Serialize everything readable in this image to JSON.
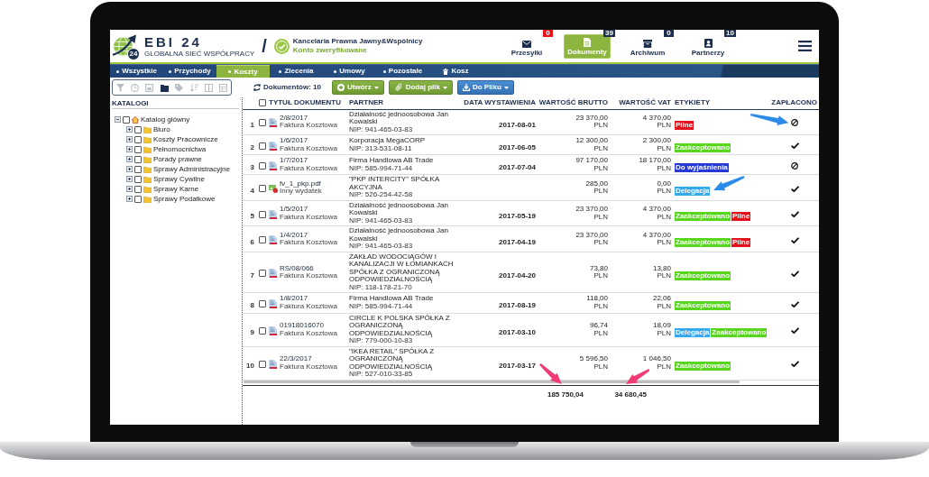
{
  "header": {
    "logo_text": "EBI 24",
    "logo_tagline": "GLOBALNA SIEĆ WSPÓŁPRACY",
    "logo_badge": "24",
    "divider": "/",
    "company": "Kancelaria Prawna Jawny&Wspólnicy",
    "account_status": "Konto zweryfikowane"
  },
  "top_nav": [
    {
      "label": "Przesyłki",
      "kind": "shipments",
      "count": "0",
      "color": "#e3141b",
      "selected": false
    },
    {
      "label": "Dokumenty",
      "kind": "documents",
      "count": "39",
      "color": "#1d2f4e",
      "selected": true
    },
    {
      "label": "Archiwum",
      "kind": "archive",
      "count": "0",
      "color": "#1d2f4e",
      "selected": false
    },
    {
      "label": "Partnerzy",
      "kind": "partners",
      "count": "10",
      "color": "#1d2f4e",
      "selected": false
    }
  ],
  "tabs": [
    {
      "label": "Wszystkie",
      "kind": "category",
      "selected": false
    },
    {
      "label": "Przychody",
      "kind": "category",
      "selected": false
    },
    {
      "label": "Koszty",
      "kind": "category",
      "selected": true
    },
    {
      "label": "Zlecenia",
      "kind": "category",
      "selected": false
    },
    {
      "label": "Umowy",
      "kind": "category",
      "selected": false
    },
    {
      "label": "Pozostałe",
      "kind": "category",
      "selected": false
    },
    {
      "label": "Kosz",
      "kind": "trash",
      "selected": false
    }
  ],
  "toolbar": {
    "tools": [
      {
        "selected": false
      },
      {
        "selected": false
      },
      {
        "selected": false
      },
      {
        "selected": true
      },
      {
        "selected": false
      },
      {
        "selected": false
      },
      {
        "selected": false
      },
      {
        "selected": false
      }
    ],
    "document_count": "Dokumentów: 10",
    "buttons": [
      {
        "label": "Utwórz",
        "kind": "create"
      },
      {
        "label": "Dodaj plik",
        "kind": "attach"
      },
      {
        "label": "Do Pliku",
        "kind": "export"
      }
    ]
  },
  "sidebar": {
    "title": "KATALOGI",
    "tree": [
      {
        "label": "Katalog główny",
        "expanded": true,
        "checked": false,
        "children": [
          {
            "label": "Biuro",
            "expanded": false,
            "checked": false
          },
          {
            "label": "Koszty Pracownicze",
            "expanded": false,
            "checked": false
          },
          {
            "label": "Pełnomocnictwa",
            "expanded": false,
            "checked": false
          },
          {
            "label": "Porady prawne",
            "expanded": false,
            "checked": false
          },
          {
            "label": "Sprawy Administracyjne",
            "expanded": false,
            "checked": false
          },
          {
            "label": "Sprawy Cywilne",
            "expanded": false,
            "checked": false
          },
          {
            "label": "Sprawy Karne",
            "expanded": false,
            "checked": false
          },
          {
            "label": "Sprawy Podatkowe",
            "expanded": false,
            "checked": false
          }
        ]
      }
    ]
  },
  "table": {
    "select_all": {
      "checked": false
    },
    "columns": [
      "TYTUŁ DOKUMENTU",
      "PARTNER",
      "DATA WYSTAWIENIA",
      "WARTOŚĆ BRUTTO",
      "WARTOŚĆ VAT",
      "ETYKIETY",
      "ZAPŁACONO"
    ],
    "rows": [
      {
        "number": "1",
        "checked": false,
        "kind": "invoice",
        "title": "2/8/2017",
        "type": "Faktura Kosztowa",
        "partner": "Działalność jednoosobowa Jan Kowalski",
        "nip": "NIP: 941-465-03-83",
        "date": "2017-08-01",
        "gross": "23 370,00",
        "gross_currency": "PLN",
        "vat": "4 370,00",
        "vat_currency": "PLN",
        "tags": [
          {
            "label": "Pilne",
            "color": "#e3111b"
          }
        ],
        "paid": false
      },
      {
        "number": "2",
        "checked": false,
        "kind": "invoice",
        "title": "1/6/2017",
        "type": "Faktura Kosztowa",
        "partner": "Korporacja MegaCORP",
        "nip": "NIP: 313-531-08-11",
        "date": "2017-06-05",
        "gross": "12 300,00",
        "gross_currency": "PLN",
        "vat": "2 300,00",
        "vat_currency": "PLN",
        "tags": [
          {
            "label": "Zaakceptowano",
            "color": "#58d61e"
          }
        ],
        "paid": true
      },
      {
        "number": "3",
        "checked": false,
        "kind": "invoice",
        "title": "1/7/2017",
        "type": "Faktura Kosztowa",
        "partner": "Firma Handlowa AB Trade",
        "nip": "NIP: 585-994-71-44",
        "date": "2017-07-04",
        "gross": "97 170,00",
        "gross_currency": "PLN",
        "vat": "18 170,00",
        "vat_currency": "PLN",
        "tags": [
          {
            "label": "Do wyjaśnienia",
            "color": "#2639d6"
          }
        ],
        "paid": false
      },
      {
        "number": "4",
        "checked": false,
        "kind": "attachment",
        "title": "fv_1_pkp.pdf",
        "type": "Inny wydatek",
        "partner": "\"PKP INTERCITY\" SPÓŁKA AKCYJNA",
        "nip": "NIP: 526-254-42-58",
        "gross": "285,00",
        "gross_currency": "PLN",
        "vat": "0,00",
        "vat_currency": "PLN",
        "tags": [
          {
            "label": "Delegacja",
            "color": "#35a8ef"
          }
        ],
        "paid": true
      },
      {
        "number": "5",
        "checked": false,
        "kind": "invoice",
        "title": "1/5/2017",
        "type": "Faktura Kosztowa",
        "partner": "Działalność jednoosobowa Jan Kowalski",
        "nip": "NIP: 941-465-03-83",
        "date": "2017-05-19",
        "gross": "23 370,00",
        "gross_currency": "PLN",
        "vat": "4 370,00",
        "vat_currency": "PLN",
        "tags": [
          {
            "label": "Zaakceptowano",
            "color": "#58d61e"
          },
          {
            "label": "Pilne",
            "color": "#e3111b"
          }
        ],
        "paid": true
      },
      {
        "number": "6",
        "checked": false,
        "kind": "invoice",
        "title": "1/4/2017",
        "type": "Faktura Kosztowa",
        "partner": "Działalność jednoosobowa Jan Kowalski",
        "nip": "NIP: 941-465-03-83",
        "date": "2017-04-19",
        "gross": "23 370,00",
        "gross_currency": "PLN",
        "vat": "4 370,00",
        "vat_currency": "PLN",
        "tags": [
          {
            "label": "Zaakceptowano",
            "color": "#58d61e"
          },
          {
            "label": "Pilne",
            "color": "#e3111b"
          }
        ],
        "paid": true
      },
      {
        "number": "7",
        "checked": false,
        "kind": "invoice",
        "title": "RS/08/066",
        "type": "Faktura Kosztowa",
        "partner": "ZAKŁAD WODOCIĄGÓW I KANALIZACJI W ŁOMIANKACH SPÓŁKA Z OGRANICZONĄ ODPOWIEDZIALNOŚCIĄ",
        "nip": "NIP: 118-178-21-70",
        "date": "2017-04-20",
        "gross": "73,80",
        "gross_currency": "PLN",
        "vat": "13,80",
        "vat_currency": "PLN",
        "tags": [
          {
            "label": "Zaakceptowano",
            "color": "#58d61e"
          }
        ],
        "paid": true
      },
      {
        "number": "8",
        "checked": false,
        "kind": "invoice",
        "title": "1/8/2017",
        "type": "Faktura Kosztowa",
        "partner": "Firma Handlowa AB Trade",
        "nip": "NIP: 585-994-71-44",
        "date": "2017-08-19",
        "gross": "118,00",
        "gross_currency": "PLN",
        "vat": "22,06",
        "vat_currency": "PLN",
        "tags": [
          {
            "label": "Zaakceptowano",
            "color": "#58d61e"
          }
        ],
        "paid": true
      },
      {
        "number": "9",
        "checked": false,
        "kind": "invoice",
        "title": "01918016070",
        "type": "Faktura Kosztowa",
        "partner": "CIRCLE K POLSKA SPÓŁKA Z OGRANICZONĄ ODPOWIEDZIALNOŚCIĄ",
        "nip": "NIP: 779-000-10-83",
        "date": "2017-03-10",
        "gross": "96,74",
        "gross_currency": "PLN",
        "vat": "18,09",
        "vat_currency": "PLN",
        "tags": [
          {
            "label": "Delegacja",
            "color": "#35a8ef"
          },
          {
            "label": "Zaakceptowano",
            "color": "#58d61e"
          }
        ],
        "paid": true
      },
      {
        "number": "10",
        "checked": false,
        "kind": "invoice",
        "title": "22/3/2017",
        "type": "Faktura Kosztowa",
        "partner": "\"IKEA RETAIL\" SPÓŁKA Z OGRANICZONĄ ODPOWIEDZIALNOŚCIĄ",
        "nip": "NIP: 527-010-33-85",
        "date": "2017-03-17",
        "gross": "5 596,50",
        "gross_currency": "PLN",
        "vat": "1 046,50",
        "vat_currency": "PLN",
        "tags": [
          {
            "label": "Zaakceptowano",
            "color": "#58d61e"
          }
        ],
        "paid": true
      }
    ],
    "totals": {
      "gross": "185 750,04",
      "vat": "34 680,45"
    }
  }
}
